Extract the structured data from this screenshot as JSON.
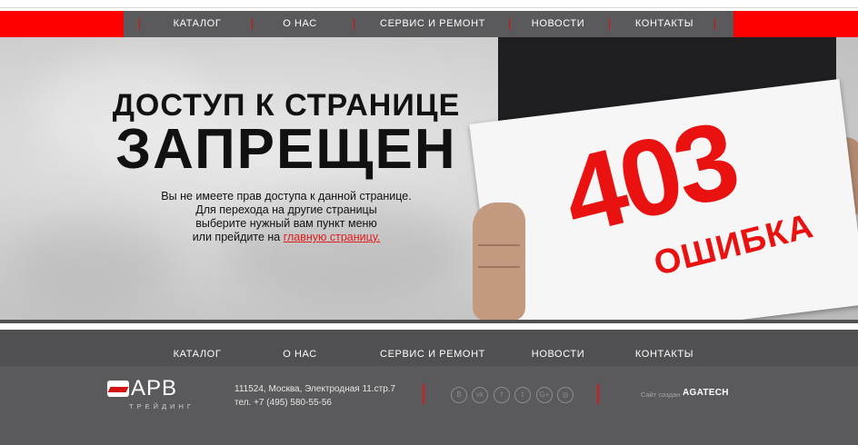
{
  "nav": {
    "items": [
      {
        "label": "КАТАЛОГ"
      },
      {
        "label": "О НАС"
      },
      {
        "label": "СЕРВИС И РЕМОНТ"
      },
      {
        "label": "НОВОСТИ"
      },
      {
        "label": "КОНТАКТЫ"
      }
    ]
  },
  "hero": {
    "title_line1": "ДОСТУП К СТРАНИЦЕ",
    "title_line2": "ЗАПРЕЩЕН",
    "message_lines": [
      "Вы не имеете прав доступа к данной странице.",
      "Для перехода на другие страницы",
      "выберите нужный вам пункт меню"
    ],
    "message_last_prefix": "или прейдите на ",
    "home_link": "главную страницу.",
    "sign_code": "403",
    "sign_word": "ОШИБКА"
  },
  "footer": {
    "logo_text": "АРВ",
    "logo_sub": "ТРЕЙДИНГ",
    "address": "111524, Москва, Электродная 11.стр.7",
    "phone": "тел. +7 (495) 580-55-56",
    "social": [
      {
        "icon": "vkontakte-b-icon",
        "glyph": "B"
      },
      {
        "icon": "vk-icon",
        "glyph": "vk"
      },
      {
        "icon": "facebook-icon",
        "glyph": "f"
      },
      {
        "icon": "twitter-icon",
        "glyph": "t"
      },
      {
        "icon": "google-plus-icon",
        "glyph": "G+"
      },
      {
        "icon": "instagram-icon",
        "glyph": "◎"
      }
    ],
    "made_by": "Сайт создан",
    "agency": "AGATECH"
  },
  "colors": {
    "accent": "#ff0000",
    "nav_bg": "#5a5a5c",
    "footer_bg": "#5a5a5c",
    "link": "#e41b1b"
  }
}
